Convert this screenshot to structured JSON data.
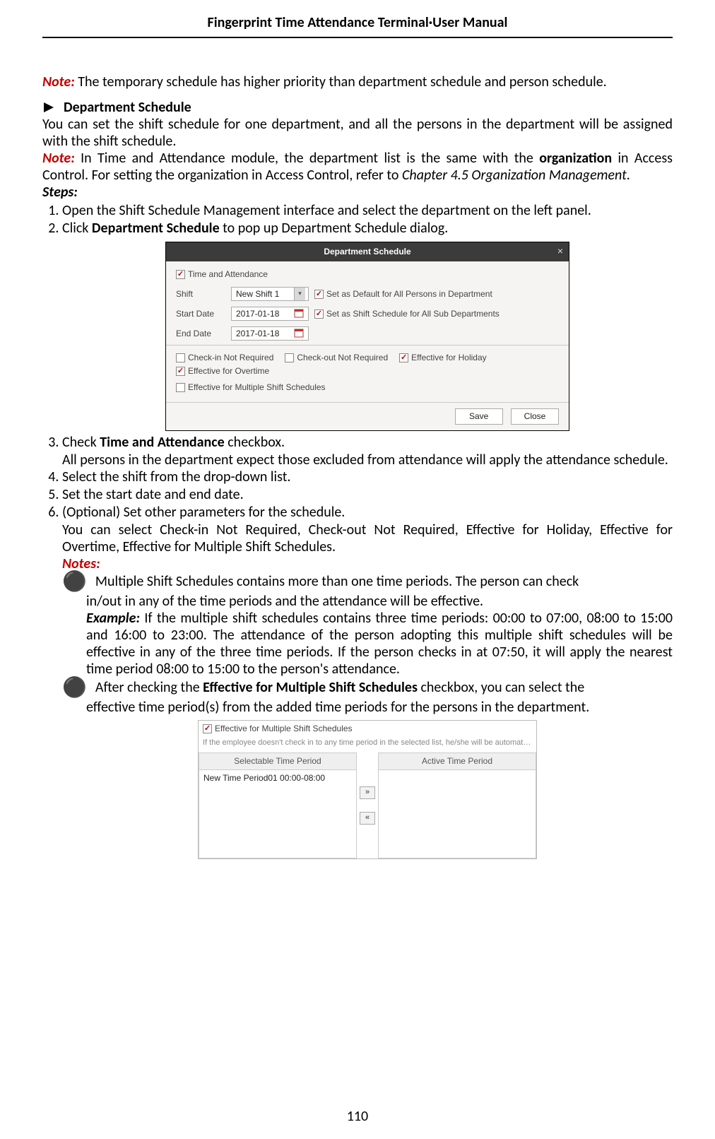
{
  "page": {
    "header": "Fingerprint Time Attendance Terminal·User Manual",
    "page_number": "110"
  },
  "intro_note": {
    "label": "Note:",
    "text": " The temporary schedule has higher priority than department schedule and person schedule."
  },
  "section": {
    "title": "Department Schedule",
    "para1": "You can set the shift schedule for one department, and all the persons in the department will be assigned with the shift schedule.",
    "note": {
      "label": "Note:",
      "t1": " In Time and Attendance module, the department list is the same with the ",
      "t2_bold": "organization",
      "t3": " in Access Control. For setting the organization in Access Control, refer to ",
      "t4_italic": "Chapter 4.5 Organization Management",
      "t5": "."
    },
    "steps_label": "Steps:"
  },
  "steps": {
    "s1": "Open the Shift Schedule Management interface and select the department on the left panel.",
    "s2_a": "Click ",
    "s2_b_bold": "Department Schedule",
    "s2_c": " to pop up Department Schedule dialog.",
    "s3_a": "Check ",
    "s3_b_bold": "Time and Attendance",
    "s3_c": " checkbox.",
    "s3_detail": "All persons in the department expect those excluded from attendance will apply the attendance schedule.",
    "s4": "Select the shift from the drop-down list.",
    "s5": "Set the start date and end date.",
    "s6": "(Optional) Set other parameters for the schedule.",
    "s6_detail": "You can select Check-in Not Required, Check-out Not Required, Effective for Holiday, Effective for Overtime, Effective for Multiple Shift Schedules.",
    "s6_notes_label": "Notes:"
  },
  "bullets": {
    "b1_line1": "Multiple Shift Schedules contains more than one time periods. The person can check",
    "b1_line2": "in/out in any of the time periods and the attendance will be effective.",
    "b1_example_label": "Example:",
    "b1_example_text": " If the multiple shift schedules contains three time periods: 00:00 to 07:00, 08:00 to 15:00 and 16:00 to 23:00. The attendance of the person adopting this multiple shift schedules will be effective in any of the three time periods. If the person checks in at 07:50, it will apply the nearest time period 08:00 to 15:00 to the person's attendance.",
    "b2_a": "After checking the ",
    "b2_b_bold": "Effective for Multiple Shift Schedules",
    "b2_c": " checkbox, you can select the",
    "b2_line2": "effective time period(s) from the added time periods for the persons in the department."
  },
  "dialog": {
    "title": "Department Schedule",
    "ta_label": "Time and Attendance",
    "shift_label": "Shift",
    "shift_value": "New Shift 1",
    "start_label": "Start Date",
    "start_value": "2017-01-18",
    "end_label": "End Date",
    "end_value": "2017-01-18",
    "opt_default": "Set as Default for All Persons in Department",
    "opt_subdept": "Set as Shift Schedule for All Sub Departments",
    "opt_checkin": "Check-in Not Required",
    "opt_checkout": "Check-out Not Required",
    "opt_holiday": "Effective for Holiday",
    "opt_overtime": "Effective for Overtime",
    "opt_multi": "Effective for Multiple Shift Schedules",
    "btn_save": "Save",
    "btn_close": "Close"
  },
  "msp": {
    "top_label": "Effective for Multiple Shift Schedules",
    "hint": "If the employee doesn't check in to any time period in the selected list, he/she will be automatically ...",
    "col_left": "Selectable Time Period",
    "col_right": "Active Time Period",
    "item1": "New Time Period01 00:00-08:00",
    "btn_right": "»",
    "btn_left": "«"
  }
}
